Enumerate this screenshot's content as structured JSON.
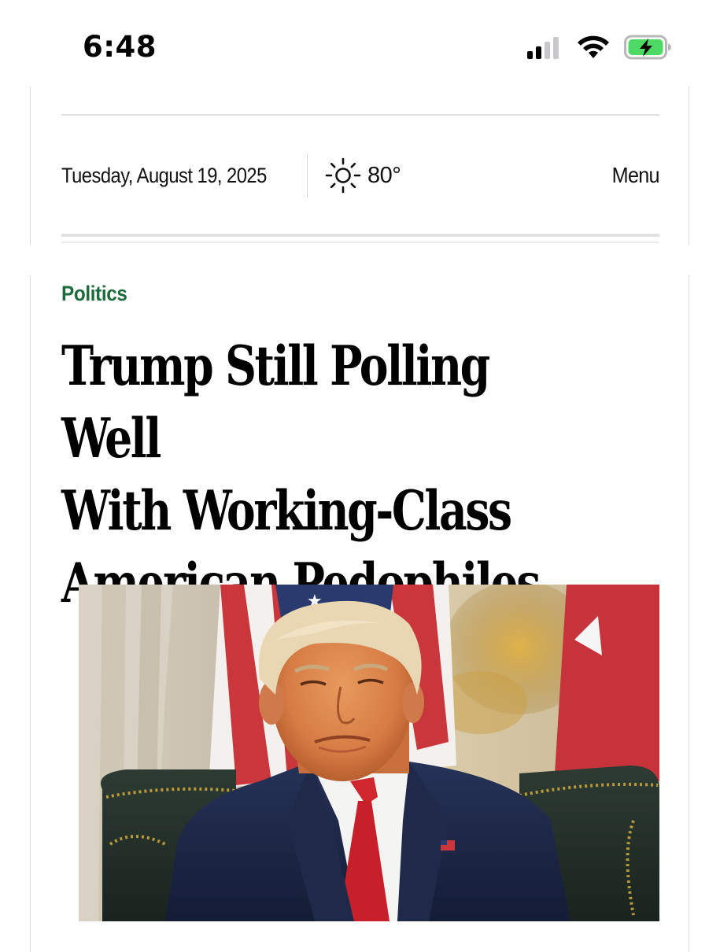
{
  "status_bar": {
    "time": "6:48",
    "icons": [
      "signal-icon",
      "wifi-icon",
      "battery-charging-icon"
    ],
    "battery_color": "#4cd964"
  },
  "header": {
    "date": "Tuesday, August 19, 2025",
    "weather_icon": "sun-icon",
    "temperature": "80°",
    "menu_label": "Menu"
  },
  "article": {
    "category": "Politics",
    "category_color": "#1d6b3d",
    "headline_lines": [
      "Trump Still Polling Well",
      "With Working-Class",
      "American Pedophiles"
    ],
    "image": "photo of a man in a navy suit and red tie seated in a green armchair before flags"
  }
}
